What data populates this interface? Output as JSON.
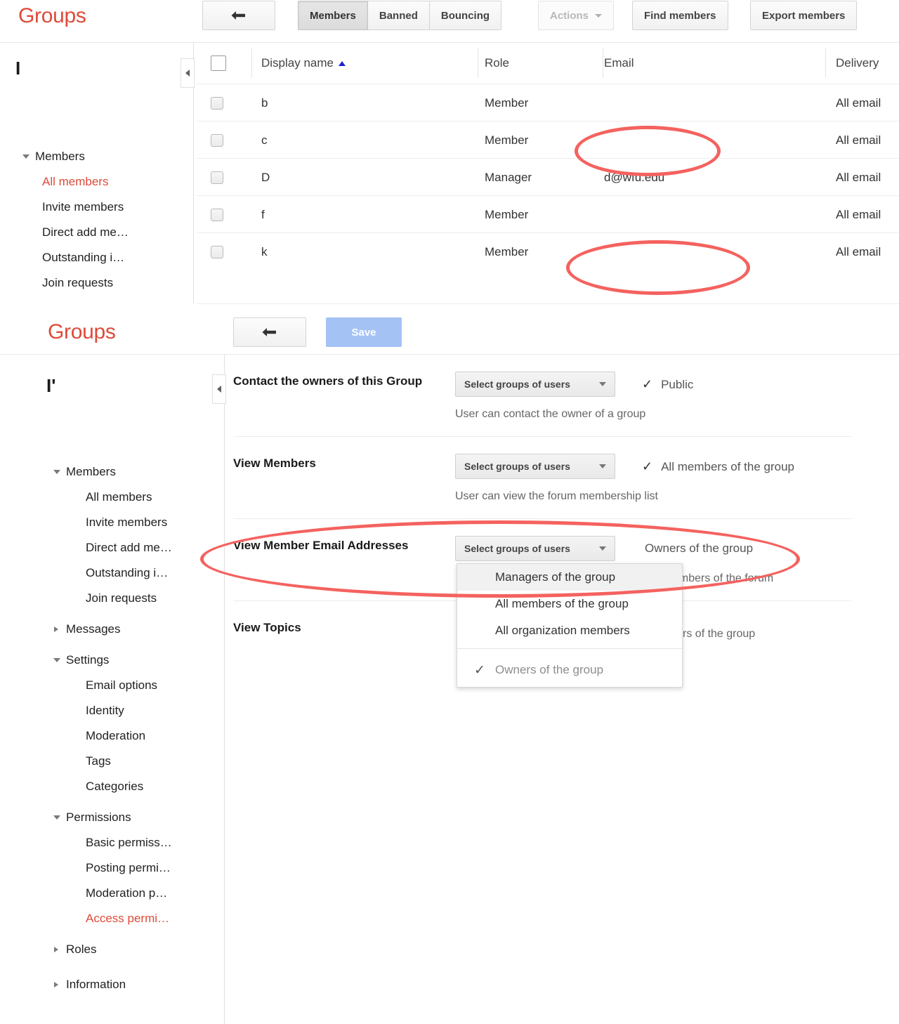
{
  "brand": {
    "title": "Groups"
  },
  "panel1": {
    "toolbar": {
      "back_label": "",
      "tabs": [
        {
          "label": "Members",
          "active": true
        },
        {
          "label": "Banned",
          "active": false
        },
        {
          "label": "Bouncing",
          "active": false
        }
      ],
      "actions_label": "Actions",
      "find_members_label": "Find members",
      "export_members_label": "Export members"
    },
    "group_name": "I",
    "sidebar": [
      {
        "label": "Members",
        "type": "group",
        "expanded": true
      },
      {
        "label": "All members",
        "type": "leaf",
        "selected": true
      },
      {
        "label": "Invite members",
        "type": "leaf",
        "selected": false
      },
      {
        "label": "Direct add me…",
        "type": "leaf",
        "selected": false
      },
      {
        "label": "Outstanding i…",
        "type": "leaf",
        "selected": false
      },
      {
        "label": "Join requests",
        "type": "leaf",
        "selected": false
      }
    ],
    "table": {
      "columns": [
        "Display name",
        "Role",
        "Email",
        "Delivery"
      ],
      "sort_column": "Display name",
      "sort_direction": "asc",
      "rows": [
        {
          "name": "b",
          "role": "Member",
          "email": "",
          "delivery": "All email"
        },
        {
          "name": "c",
          "role": "Member",
          "email": "",
          "delivery": "All email"
        },
        {
          "name": "D",
          "role": "Manager",
          "email": "d@wfu.edu",
          "delivery": "All email"
        },
        {
          "name": "f\u0001",
          "role": "Member",
          "email": "",
          "delivery": "All email"
        },
        {
          "name": "k",
          "role": "Member",
          "email": "",
          "delivery": "All email"
        }
      ]
    }
  },
  "panel2": {
    "toolbar": {
      "back_label": "",
      "save_label": "Save"
    },
    "group_name": "I'",
    "sidebar": [
      {
        "label": "Members",
        "type": "group",
        "expanded": true
      },
      {
        "label": "All members",
        "type": "leaf",
        "selected": false
      },
      {
        "label": "Invite members",
        "type": "leaf",
        "selected": false
      },
      {
        "label": "Direct add me…",
        "type": "leaf",
        "selected": false
      },
      {
        "label": "Outstanding i…",
        "type": "leaf",
        "selected": false
      },
      {
        "label": "Join requests",
        "type": "leaf",
        "selected": false
      },
      {
        "label": "Messages",
        "type": "group",
        "expanded": false
      },
      {
        "label": "Settings",
        "type": "group",
        "expanded": true
      },
      {
        "label": "Email options",
        "type": "leaf",
        "selected": false
      },
      {
        "label": "Identity",
        "type": "leaf",
        "selected": false
      },
      {
        "label": "Moderation",
        "type": "leaf",
        "selected": false
      },
      {
        "label": "Tags",
        "type": "leaf",
        "selected": false
      },
      {
        "label": "Categories",
        "type": "leaf",
        "selected": false
      },
      {
        "label": "Permissions",
        "type": "group",
        "expanded": true
      },
      {
        "label": "Basic permiss…",
        "type": "leaf",
        "selected": false
      },
      {
        "label": "Posting permi…",
        "type": "leaf",
        "selected": false
      },
      {
        "label": "Moderation p…",
        "type": "leaf",
        "selected": false
      },
      {
        "label": "Access permi…",
        "type": "leaf",
        "selected": true
      },
      {
        "label": "Roles",
        "type": "group",
        "expanded": false
      },
      {
        "label": "Information",
        "type": "group",
        "expanded": false
      }
    ],
    "settings": [
      {
        "label": "Contact the owners of this Group",
        "select_label": "Select groups of users",
        "value": "Public",
        "has_check": true,
        "help": "User can contact the owner of a group"
      },
      {
        "label": "View Members",
        "select_label": "Select groups of users",
        "value": "All members of the group",
        "has_check": true,
        "help": "User can view the forum membership list"
      },
      {
        "label": "View Member Email Addresses",
        "select_label": "Select groups of users",
        "value": "Owners of the group",
        "has_check": false,
        "help": "er members of the forum"
      },
      {
        "label": "View Topics",
        "select_label": "",
        "value": "",
        "has_check": false,
        "help": "embers of the group"
      }
    ],
    "dropdown": {
      "open": true,
      "options": [
        {
          "label": "Managers of the group",
          "highlighted": true,
          "checked": false
        },
        {
          "label": "All members of the group",
          "highlighted": false,
          "checked": false
        },
        {
          "label": "All organization members",
          "highlighted": false,
          "checked": false
        }
      ],
      "selected_option": {
        "label": "Owners of the group",
        "checked": true
      }
    }
  },
  "colors": {
    "brand_red": "#dd4b39",
    "annotation_red": "#f4625f",
    "save_blue": "#a4c2f4",
    "sort_arrow_blue": "#1a24c9"
  }
}
